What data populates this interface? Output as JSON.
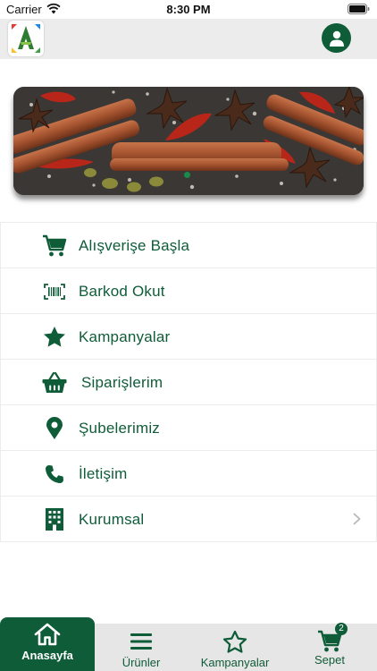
{
  "status_bar": {
    "carrier": "Carrier",
    "time": "8:30 PM"
  },
  "header": {
    "logo_icon": "brand-logo",
    "profile_icon": "user-icon"
  },
  "banner": {
    "image": "spices-cinnamon-star-anise-chili",
    "active_slide": 1,
    "total_slides": 1
  },
  "menu": {
    "items": [
      {
        "label": "Alışverişe Başla",
        "icon": "cart-icon"
      },
      {
        "label": "Barkod Okut",
        "icon": "barcode-icon"
      },
      {
        "label": "Kampanyalar",
        "icon": "star-icon"
      },
      {
        "label": "Siparişlerim",
        "icon": "basket-icon"
      },
      {
        "label": "Şubelerimiz",
        "icon": "location-pin-icon"
      },
      {
        "label": "İletişim",
        "icon": "phone-icon"
      },
      {
        "label": "Kurumsal",
        "icon": "building-icon"
      }
    ]
  },
  "tabs": {
    "home": "Anasayfa",
    "products": "Ürünler",
    "campaigns": "Kampanyalar",
    "cart": "Sepet",
    "cart_count": "2"
  },
  "colors": {
    "primary": "#0f5c38",
    "header_bg": "#ececec",
    "tabbar_bg": "#e6e6e6"
  }
}
